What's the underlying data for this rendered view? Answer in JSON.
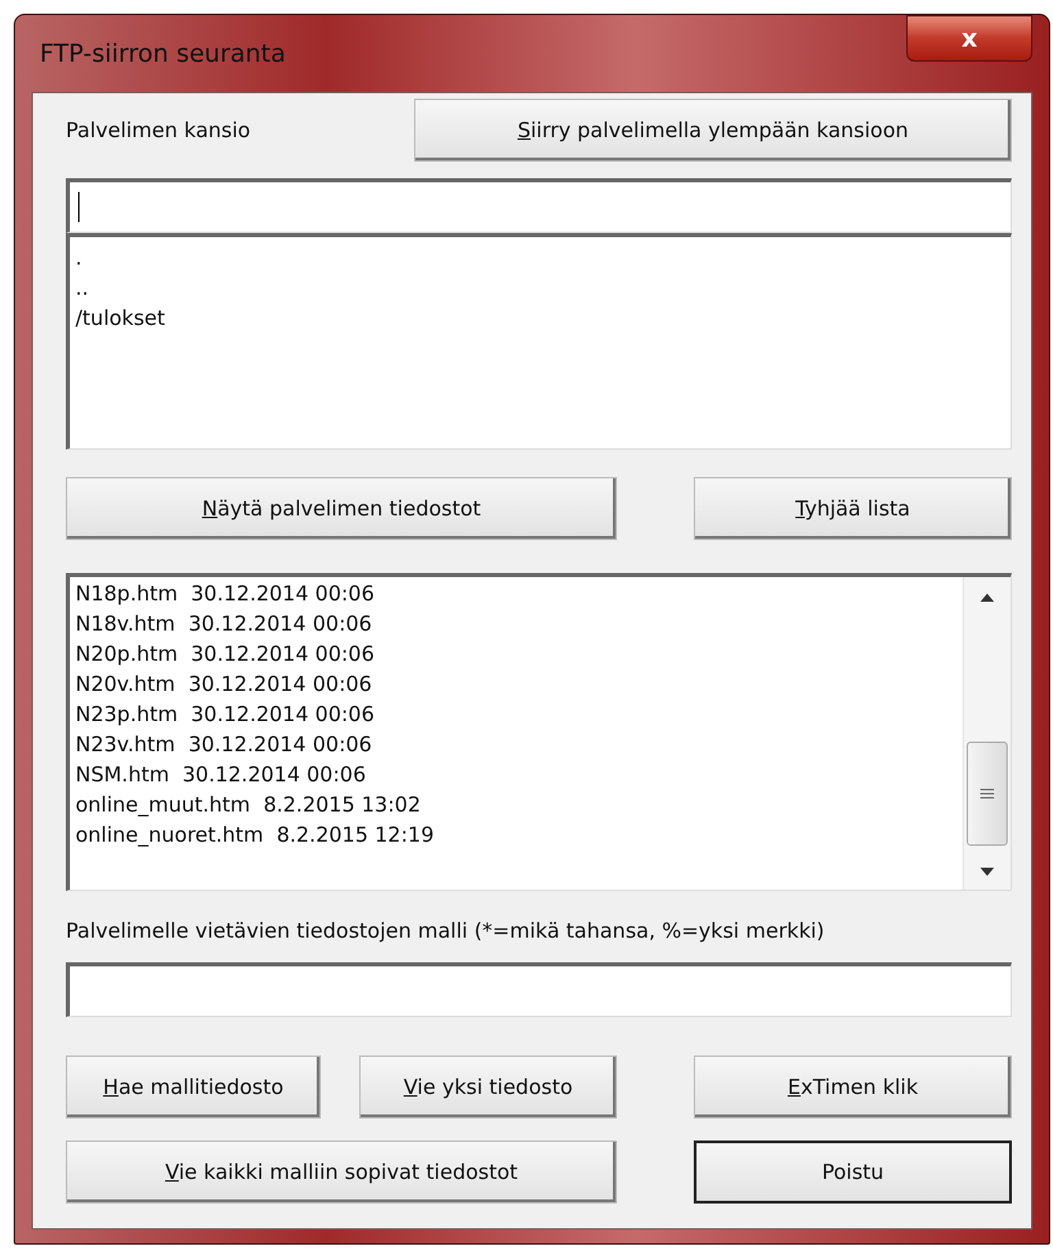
{
  "window": {
    "title": "FTP-siirron seuranta",
    "close_label": "x"
  },
  "server_folder": {
    "label": "Palvelimen kansio",
    "up_button": {
      "label": "Siirry palvelimella ylempään kansioon",
      "mnemonic": true,
      "default": false
    },
    "path": {
      "focused": true
    }
  },
  "folder_list": [
    ".",
    "..",
    "/tulokset"
  ],
  "list_buttons": [
    {
      "label": "Näytä palvelimen tiedostot",
      "mnemonic": true,
      "default": false
    },
    {
      "label": "Tyhjää lista",
      "mnemonic": true,
      "default": false
    }
  ],
  "file_list": [
    "N18p.htm  30.12.2014 00:06",
    "N18v.htm  30.12.2014 00:06",
    "N20p.htm  30.12.2014 00:06",
    "N20v.htm  30.12.2014 00:06",
    "N23p.htm  30.12.2014 00:06",
    "N23v.htm  30.12.2014 00:06",
    "NSM.htm  30.12.2014 00:06",
    "online_muut.htm  8.2.2015 13:02",
    "online_nuoret.htm  8.2.2015 12:19"
  ],
  "pattern": {
    "label": "Palvelimelle vietävien tiedostojen malli (*=mikä tahansa, %=yksi merkki)"
  },
  "bottom_buttons": [
    {
      "label": "Hae mallitiedosto",
      "mnemonic": true,
      "default": false
    },
    {
      "label": "Vie yksi tiedosto",
      "mnemonic": true,
      "default": false
    },
    {
      "label": "ExTimen klik",
      "mnemonic": true,
      "default": false
    },
    {
      "label": "Vie kaikki malliin sopivat tiedostot",
      "mnemonic": true,
      "default": false
    },
    {
      "label": "Poistu",
      "mnemonic": false,
      "default": true
    }
  ]
}
